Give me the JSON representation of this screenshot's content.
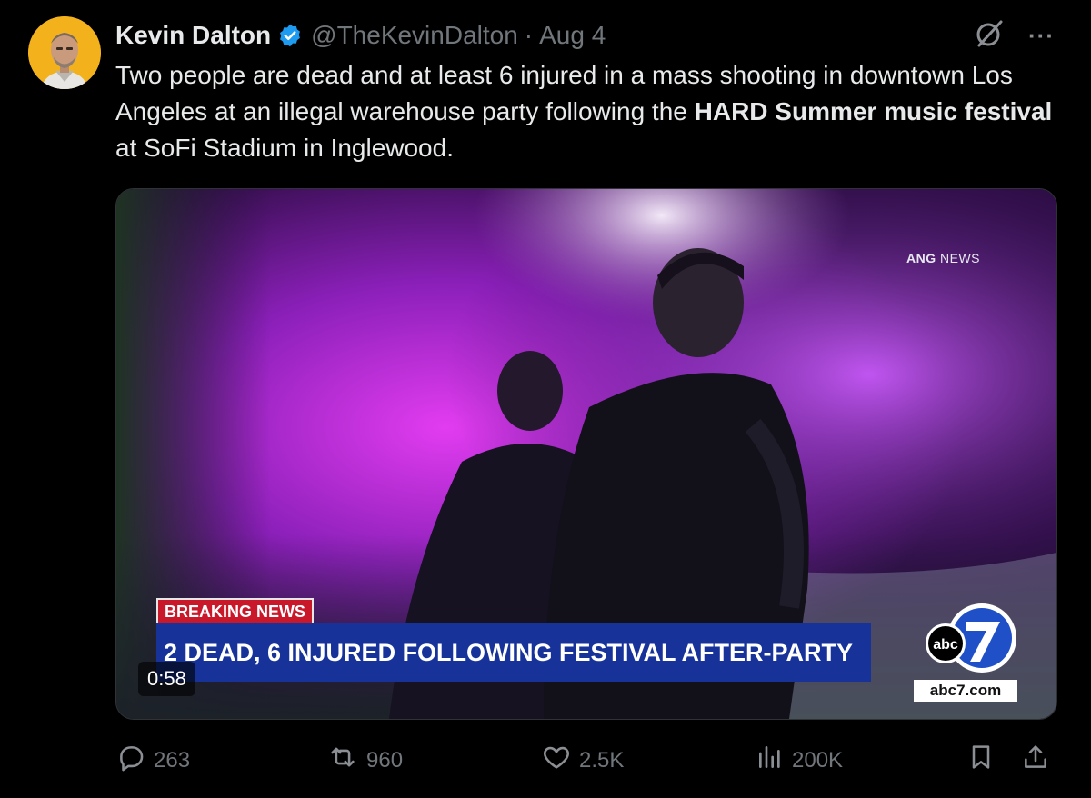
{
  "author": {
    "name": "Kevin Dalton",
    "handle": "@TheKevinDalton",
    "separator": "·",
    "date": "Aug 4",
    "verified_color": "#1d9bf0",
    "avatar_bg": "#f3b21b"
  },
  "icons": {
    "grok": "grok-icon",
    "more": "more-options-icon",
    "more_glyph": "···"
  },
  "tweet": {
    "text_part1": "Two people are dead and at least 6 injured in a mass shooting in downtown Los Angeles at an illegal warehouse party following the ",
    "text_bold": "HARD Summer music festival",
    "text_part2": " at SoFi Stadium in Inglewood."
  },
  "media": {
    "watermark_bold": "ANG",
    "watermark_rest": "NEWS",
    "breaking_label": "BREAKING NEWS",
    "headline": "2 DEAD, 6 INJURED FOLLOWING FESTIVAL AFTER-PARTY",
    "duration": "0:58",
    "station_logo_text": "abc",
    "station_logo_number": "7",
    "station_url": "abc7.com",
    "breaking_color": "#c8182a",
    "headline_color": "#17339a"
  },
  "actions": {
    "replies": "263",
    "reposts": "960",
    "likes": "2.5K",
    "views": "200K"
  }
}
